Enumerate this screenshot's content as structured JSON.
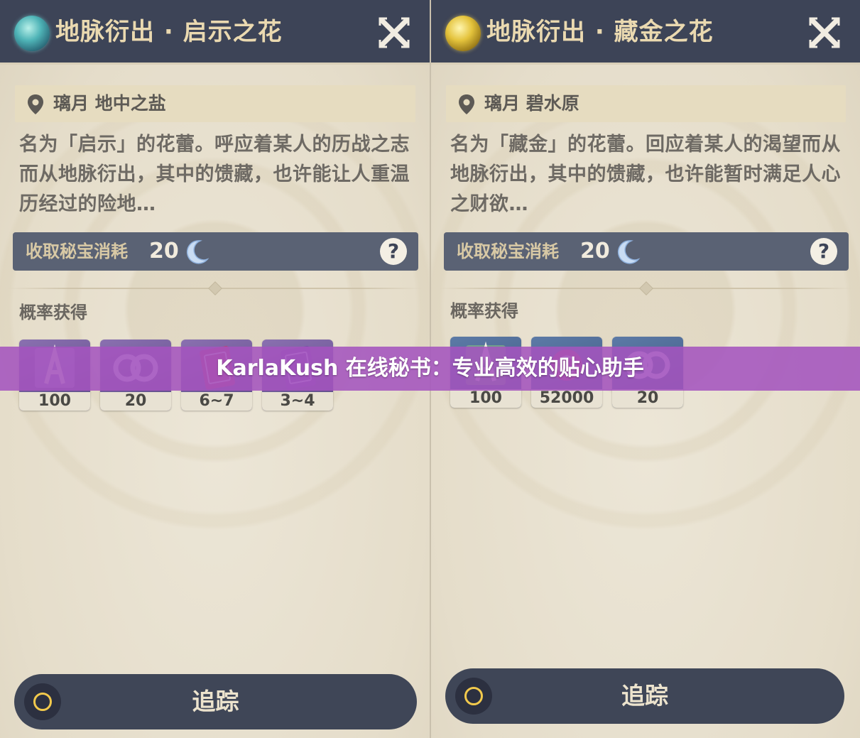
{
  "left_panel": {
    "title": "地脉衍出 · 启示之花",
    "gem_icon": "blue-leyline-gem-icon",
    "location": "璃月 地中之盐",
    "description": "名为「启示」的花蕾。呼应着某人的历战之志而从地脉衍出，其中的馈藏，也许能让人重温历经过的险地…",
    "cost_label": "收取秘宝消耗",
    "cost_value": "20",
    "help": "?",
    "drops_label": "概率获得",
    "drops": [
      {
        "icon": "adventure-exp-icon",
        "count": "100"
      },
      {
        "icon": "companionship-exp-icon",
        "count": "20"
      },
      {
        "icon": "heros-wit-book-icon",
        "count": "6~7"
      },
      {
        "icon": "adventurers-experience-book-icon",
        "count": "3~4"
      }
    ],
    "track_label": "追踪"
  },
  "right_panel": {
    "title": "地脉衍出 · 藏金之花",
    "gem_icon": "gold-leyline-gem-icon",
    "location": "璃月 碧水原",
    "description": "名为「藏金」的花蕾。回应着某人的渴望而从地脉衍出，其中的馈藏，也许能暂时满足人心之财欲…",
    "cost_label": "收取秘宝消耗",
    "cost_value": "20",
    "help": "?",
    "drops_label": "概率获得",
    "drops": [
      {
        "icon": "adventure-exp-icon",
        "count": "100"
      },
      {
        "icon": "mora-icon",
        "count": "52000"
      },
      {
        "icon": "companionship-exp-icon",
        "count": "20"
      }
    ],
    "track_label": "追踪"
  },
  "banner": {
    "text": "KarlaKush 在线秘书：专业高效的贴心助手",
    "color": "#a454be"
  },
  "colors": {
    "header": "#3d4457",
    "cost_bar": "#5a6274",
    "track_ring": "#f2c94c"
  }
}
